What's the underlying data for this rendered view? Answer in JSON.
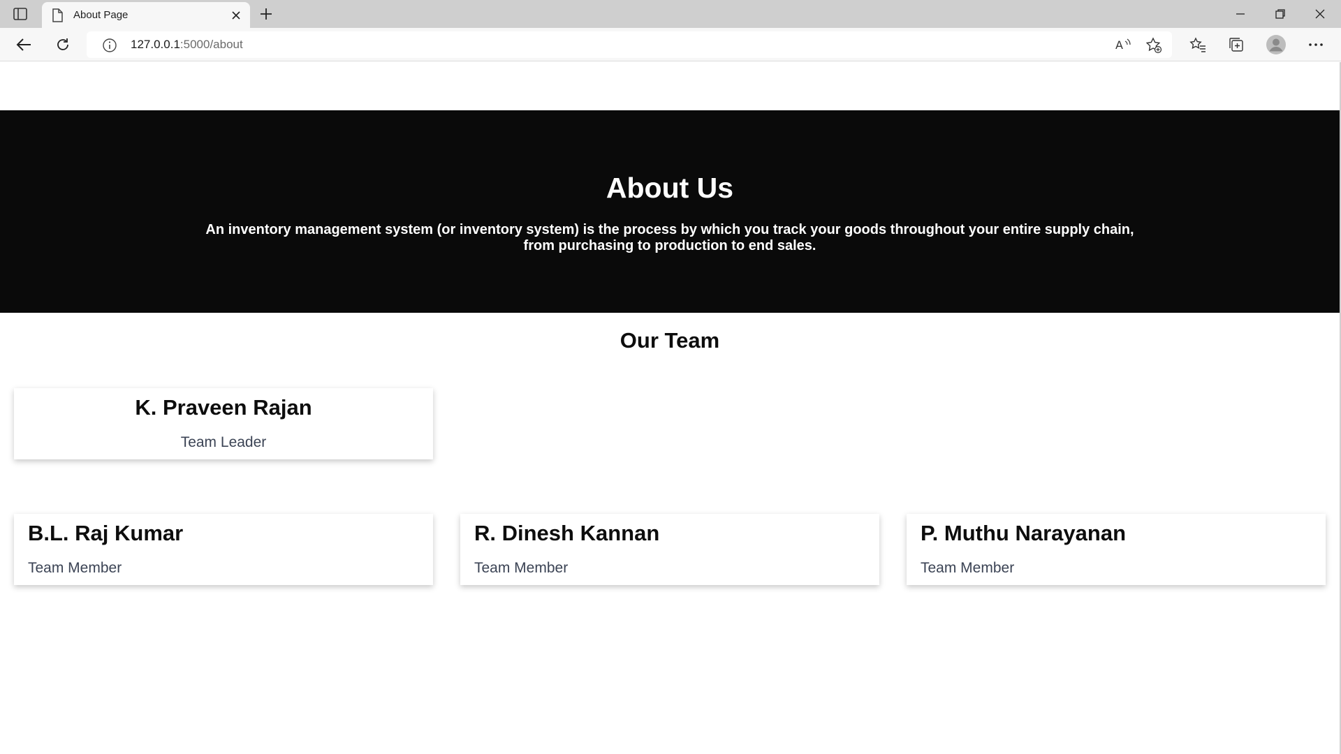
{
  "browser": {
    "tab_title": "About Page",
    "url_host": "127.0.0.1",
    "url_rest": ":5000/about"
  },
  "hero": {
    "title": "About Us",
    "description": "An inventory management system (or inventory system) is the process by which you track your goods throughout your entire supply chain, from purchasing to production to end sales."
  },
  "team": {
    "heading": "Our Team",
    "leader": {
      "name": "K. Praveen Rajan",
      "role": "Team Leader"
    },
    "members": [
      {
        "name": "B.L. Raj Kumar",
        "role": "Team Member"
      },
      {
        "name": "R. Dinesh Kannan",
        "role": "Team Member"
      },
      {
        "name": "P. Muthu Narayanan",
        "role": "Team Member"
      }
    ]
  },
  "icons": {
    "tab_sidebar": "tab-actions-icon",
    "tab": "document-icon",
    "close": "close-icon",
    "new_tab": "plus-icon",
    "minimize": "minimize-icon",
    "restore": "restore-icon",
    "close_window": "close-window-icon",
    "back": "back-arrow-icon",
    "refresh": "refresh-icon",
    "info": "info-icon",
    "read_aloud": "read-aloud-icon",
    "add_favorite": "star-plus-icon",
    "favorites": "favorites-icon",
    "collections": "collections-icon",
    "profile": "profile-icon",
    "more": "more-icon"
  },
  "colors": {
    "hero_bg": "#0a0a0a",
    "role_text": "#3b4354",
    "chrome_bg": "#cfcfcf"
  }
}
